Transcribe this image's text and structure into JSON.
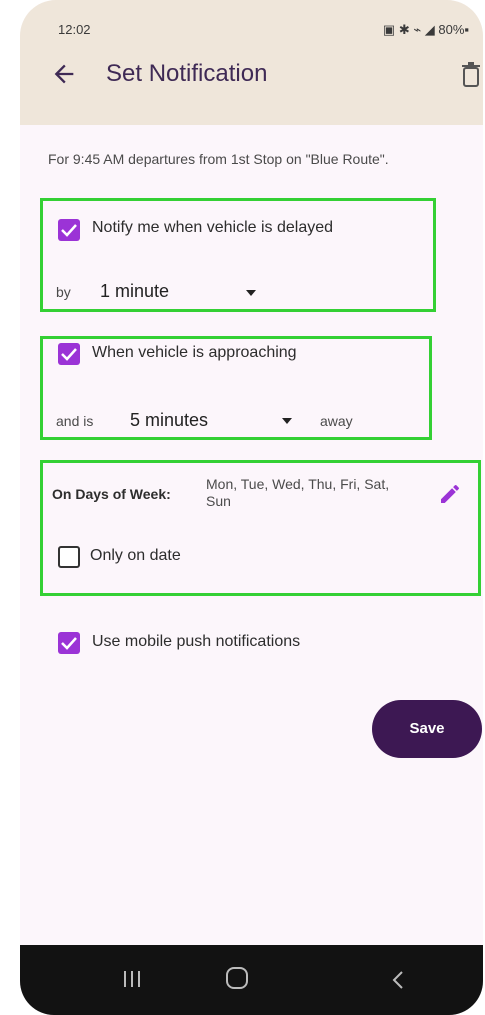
{
  "status_bar": {
    "time": "12:02",
    "icons_right": "▣ ✱ ⌁ ◢ 80%▪"
  },
  "app_bar": {
    "title": "Set Notification",
    "back_icon": "arrow-back",
    "delete_icon": "trash"
  },
  "description": "For 9:45 AM departures from 1st Stop on \"Blue Route\".",
  "delay_section": {
    "checkbox_label": "Notify me when vehicle is delayed",
    "checked": true,
    "by_label": "by",
    "selected_value": "1 minute"
  },
  "approach_section": {
    "checkbox_label": "When vehicle is approaching",
    "checked": true,
    "prefix_label": "and is",
    "selected_value": "5 minutes",
    "suffix_label": "away"
  },
  "days_section": {
    "label": "On Days of Week:",
    "days": "Mon, Tue, Wed, Thu, Fri, Sat, Sun",
    "only_on_date_label": "Only on date",
    "only_on_date_checked": false
  },
  "push": {
    "label": "Use mobile push notifications",
    "checked": true
  },
  "save_label": "Save",
  "colors": {
    "accent": "#9b33d6",
    "primary_dark": "#3d1853",
    "app_bar_bg": "#efe6da",
    "highlight_border": "#34d034"
  }
}
